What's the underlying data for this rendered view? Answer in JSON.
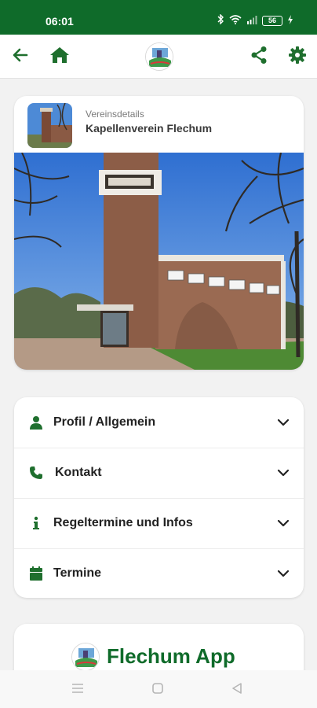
{
  "status": {
    "time": "06:01",
    "battery": "56"
  },
  "app_bar": {
    "back_icon": "arrow-left-icon",
    "home_icon": "home-icon",
    "logo": "flechum-logo",
    "share_icon": "share-icon",
    "settings_icon": "gear-icon"
  },
  "club": {
    "caption": "Vereinsdetails",
    "name": "Kapellenverein Flechum"
  },
  "accordion": [
    {
      "icon": "user-icon",
      "label": "Profil / Allgemein"
    },
    {
      "icon": "phone-icon",
      "label": "Kontakt"
    },
    {
      "icon": "info-icon",
      "label": "Regeltermine und Infos"
    },
    {
      "icon": "calendar-icon",
      "label": "Termine"
    }
  ],
  "promo": {
    "title": "Flechum App"
  },
  "colors": {
    "brand": "#0f6b2a",
    "icon": "#1f6f2e"
  }
}
